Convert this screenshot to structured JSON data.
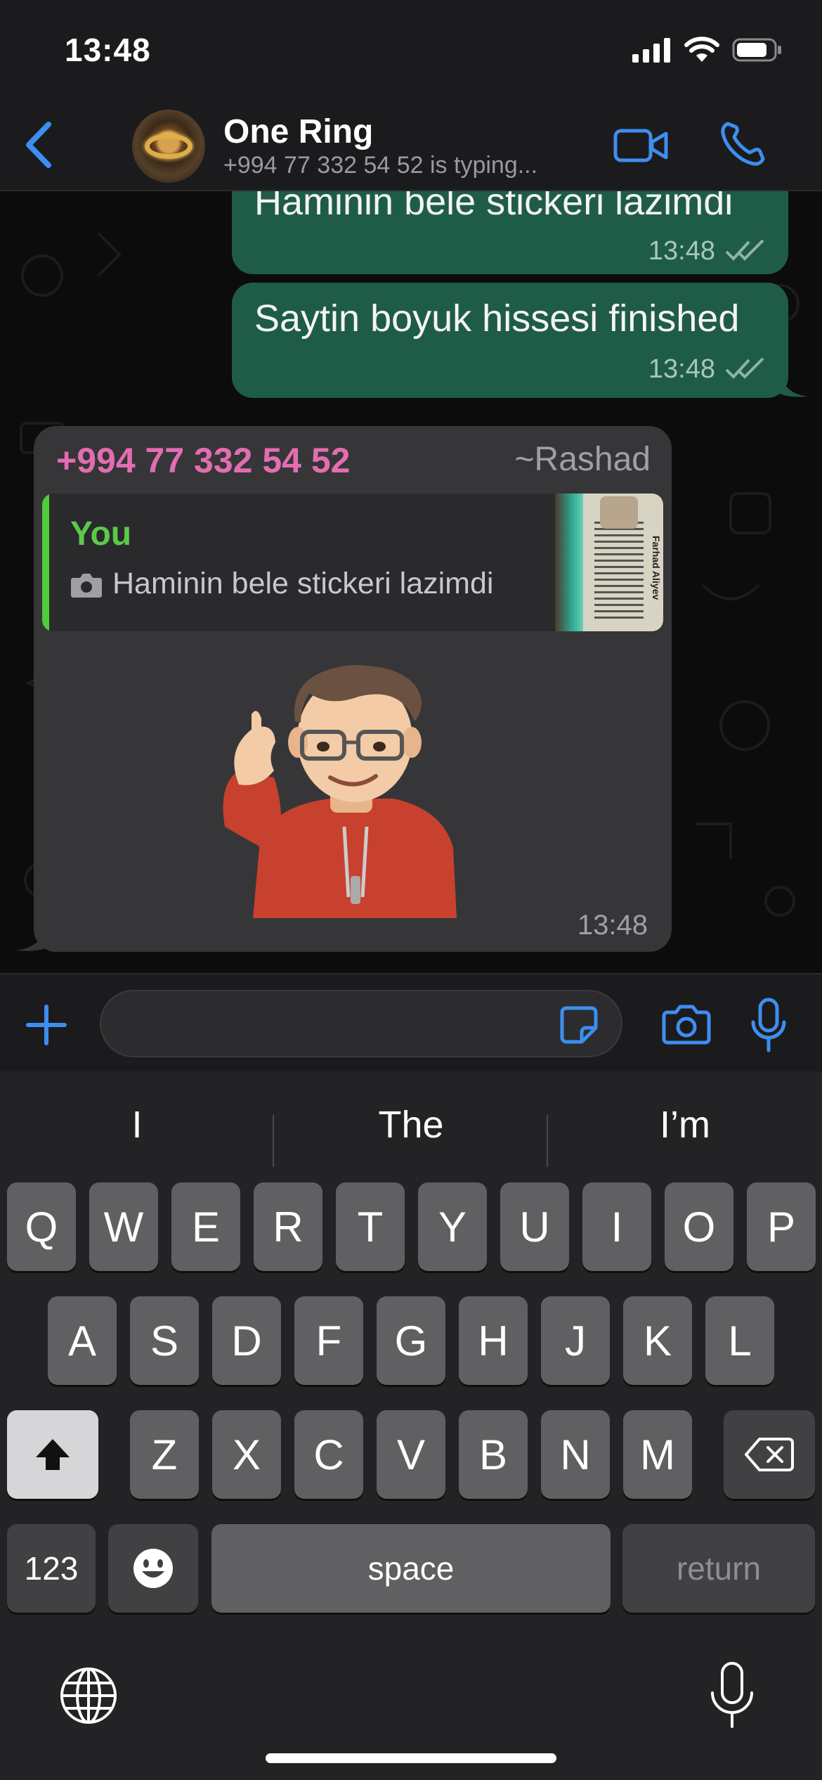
{
  "status_bar": {
    "time": "13:48",
    "icons": [
      "cellular-signal-icon",
      "wifi-icon",
      "battery-icon"
    ]
  },
  "header": {
    "contact_name": "One Ring",
    "contact_status": "+994 77 332 54 52 is typing...",
    "icons": [
      "back-chevron-icon",
      "video-call-icon",
      "phone-call-icon"
    ]
  },
  "messages": [
    {
      "direction": "outgoing",
      "text": "Haminin bele stickeri lazimdi",
      "time": "13:48",
      "status": "read"
    },
    {
      "direction": "outgoing",
      "text": "Saytin boyuk hissesi finished",
      "time": "13:48",
      "status": "read"
    },
    {
      "direction": "incoming",
      "sender_phone": "+994 77 332 54 52",
      "sender_name": "~Rashad",
      "quoted": {
        "author": "You",
        "text": "Haminin bele stickeri lazimdi",
        "thumb_caption": "Farhad Aliyev"
      },
      "time": "13:48"
    }
  ],
  "input": {
    "value": "",
    "placeholder": ""
  },
  "keyboard": {
    "suggestions": [
      "I",
      "The",
      "I’m"
    ],
    "row1": [
      "Q",
      "W",
      "E",
      "R",
      "T",
      "Y",
      "U",
      "I",
      "O",
      "P"
    ],
    "row2": [
      "A",
      "S",
      "D",
      "F",
      "G",
      "H",
      "J",
      "K",
      "L"
    ],
    "row3": [
      "Z",
      "X",
      "C",
      "V",
      "B",
      "N",
      "M"
    ],
    "numbers_label": "123",
    "space_label": "space",
    "return_label": "return"
  },
  "colors": {
    "accent": "#3d8ef0",
    "outgoing_bubble": "#1f5c48",
    "incoming_bubble": "#363638",
    "sender_phone": "#e36db0",
    "quote_author": "#5cc94a"
  }
}
